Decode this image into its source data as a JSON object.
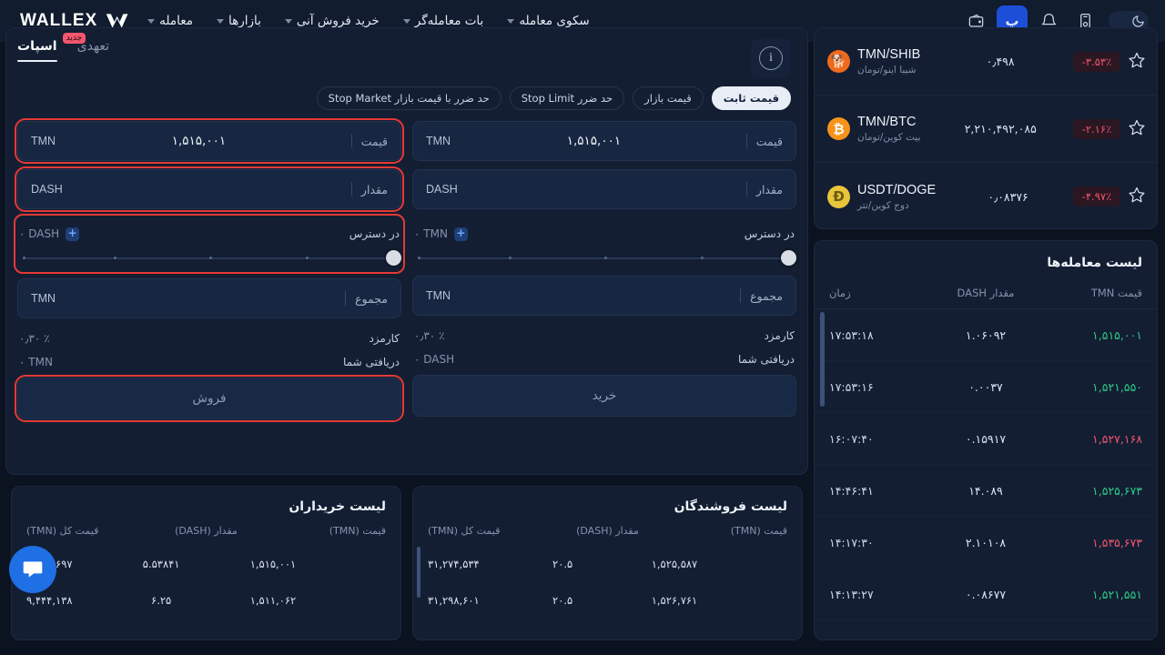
{
  "header": {
    "brand": "WALLEX",
    "nav": [
      {
        "label": "معامله",
        "caret": true
      },
      {
        "label": "بازارها",
        "caret": true
      },
      {
        "label": "خرید فروش آنی",
        "caret": true
      },
      {
        "label": "بات معامله‌گر",
        "caret": true
      },
      {
        "label": "سکوی معامله",
        "caret": true
      }
    ],
    "icons": [
      {
        "name": "wallet-icon",
        "active": false
      },
      {
        "name": "toman-icon",
        "active": true
      },
      {
        "name": "bell-icon",
        "active": false
      },
      {
        "name": "mobile-auth-icon",
        "active": false
      },
      {
        "name": "dark-mode-toggle",
        "active": false
      }
    ]
  },
  "markets": [
    {
      "pair": "TMN/SHIB",
      "fa": "شیبا اینو/تومان",
      "price": "۰٫۴۹۸",
      "change": "-۳.۵۳٪",
      "symbol": "SHIB",
      "color": "#f06a1e",
      "glyph": "🐕"
    },
    {
      "pair": "TMN/BTC",
      "fa": "بیت کوین/تومان",
      "price": "۲,۲۱۰,۴۹۲,۰۸۵",
      "change": "-۲.۱۶٪",
      "symbol": "BTC",
      "color": "#f7931a",
      "glyph": "₿"
    },
    {
      "pair": "USDT/DOGE",
      "fa": "دوج کوین/تتر",
      "price": "۰٫۰۸۳۷۶",
      "change": "-۴.۹۷٪",
      "symbol": "DOGE",
      "color": "#e8c53b",
      "glyph": "Ð"
    }
  ],
  "trades": {
    "title": "لیست معامله‌ها",
    "columns": {
      "price": "قیمت TMN",
      "amount": "مقدار DASH",
      "time": "زمان"
    },
    "rows": [
      {
        "price": "۱,۵۱۵,۰۰۱",
        "dir": "up",
        "amount": "۱.۰۶۰۹۲",
        "time": "۱۷:۵۳:۱۸"
      },
      {
        "price": "۱,۵۲۱,۵۵۰",
        "dir": "up",
        "amount": "۰.۰۰۳۷",
        "time": "۱۷:۵۳:۱۶"
      },
      {
        "price": "۱,۵۲۷,۱۶۸",
        "dir": "down",
        "amount": "۰.۱۵۹۱۷",
        "time": "۱۶:۰۷:۴۰"
      },
      {
        "price": "۱,۵۲۵,۶۷۳",
        "dir": "up",
        "amount": "۱۴.۰۸۹",
        "time": "۱۴:۴۶:۴۱"
      },
      {
        "price": "۱,۵۳۵,۶۷۳",
        "dir": "down",
        "amount": "۲.۱۰۱۰۸",
        "time": "۱۴:۱۷:۳۰"
      },
      {
        "price": "۱,۵۲۱,۵۵۱",
        "dir": "up",
        "amount": "۰.۰۸۶۷۷",
        "time": "۱۴:۱۳:۲۷"
      }
    ]
  },
  "order_panel": {
    "tabs": [
      {
        "label": "اسپات",
        "active": true,
        "badge": null
      },
      {
        "label": "تعهدی",
        "active": false,
        "badge": "جدید"
      }
    ],
    "info_icon": "i",
    "order_types": [
      {
        "label": "قیمت ثابت",
        "active": true
      },
      {
        "label": "قیمت بازار",
        "active": false
      },
      {
        "label": "حد ضرر Stop Limit",
        "active": false
      },
      {
        "label": "حد ضرر با قیمت بازار Stop Market",
        "active": false
      }
    ],
    "sell": {
      "price_label": "قیمت",
      "price_value": "۱,۵۱۵,۰۰۱",
      "price_unit": "TMN",
      "amount_label": "مقدار",
      "amount_value": "",
      "amount_unit": "DASH",
      "available_label": "در دسترس",
      "available_value": "۰",
      "available_unit": "DASH",
      "total_label": "مجموع",
      "total_value": "",
      "total_unit": "TMN",
      "fee_label": "کارمزد",
      "fee_value": "۰٫۳۰ ٪",
      "receive_label": "دریافتی شما",
      "receive_value": "۰",
      "receive_unit": "TMN",
      "button": "فروش"
    },
    "buy": {
      "price_label": "قیمت",
      "price_value": "۱,۵۱۵,۰۰۱",
      "price_unit": "TMN",
      "amount_label": "مقدار",
      "amount_value": "",
      "amount_unit": "DASH",
      "available_label": "در دسترس",
      "available_value": "۰",
      "available_unit": "TMN",
      "total_label": "مجموع",
      "total_value": "",
      "total_unit": "TMN",
      "fee_label": "کارمزد",
      "fee_value": "۰٫۳۰ ٪",
      "receive_label": "دریافتی شما",
      "receive_value": "۰",
      "receive_unit": "DASH",
      "button": "خرید"
    }
  },
  "buyers": {
    "title": "لیست خریداران",
    "columns": {
      "price": "قیمت (TMN)",
      "amount": "مقدار (DASH)",
      "total": "قیمت کل (TMN)"
    },
    "rows": [
      {
        "price": "۱,۵۱۵,۰۰۱",
        "amount": "۵.۵۳۸۴۱",
        "total": "۸,۳۹۰,۶۹۷",
        "depth": 62
      },
      {
        "price": "۱,۵۱۱,۰۶۲",
        "amount": "۶.۲۵",
        "total": "۹,۴۴۴,۱۳۸",
        "depth": 78
      }
    ]
  },
  "sellers": {
    "title": "لیست فروشندگان",
    "columns": {
      "price": "قیمت (TMN)",
      "amount": "مقدار (DASH)",
      "total": "قیمت کل (TMN)"
    },
    "rows": [
      {
        "price": "۱,۵۲۵,۵۸۷",
        "amount": "۲۰.۵",
        "total": "۳۱,۲۷۴,۵۳۴",
        "depth": 100
      },
      {
        "price": "۱,۵۲۶,۷۶۱",
        "amount": "۲۰.۵",
        "total": "۳۱,۲۹۸,۶۰۱",
        "depth": 100
      }
    ]
  },
  "chat": {
    "name": "chat-widget"
  },
  "colors": {
    "up": "#2ecc87",
    "down": "#f2566f",
    "accent": "#1d4ed8",
    "highlight": "#e53935",
    "panel": "#131e33",
    "background": "#0b1220"
  }
}
